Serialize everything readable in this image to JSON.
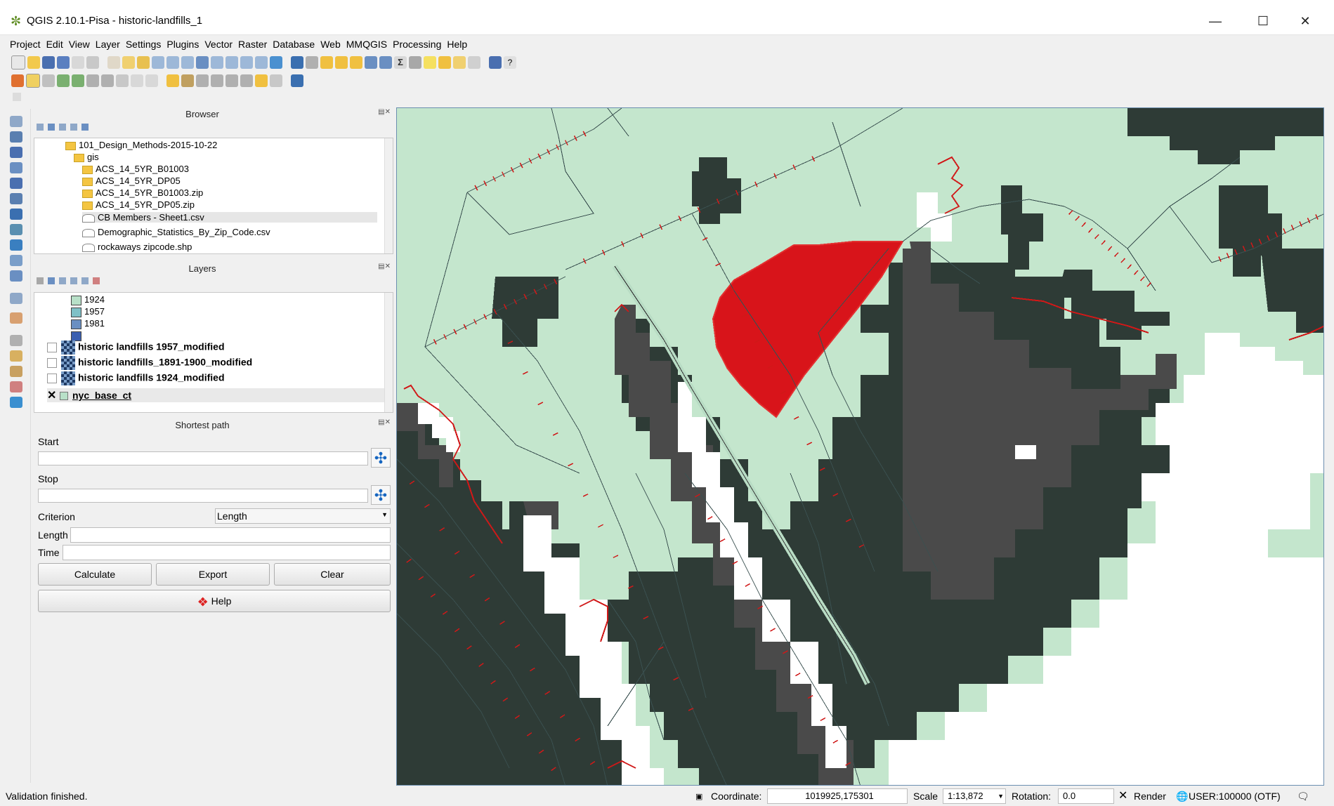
{
  "window": {
    "title": "QGIS 2.10.1-Pisa - historic-landfills_1",
    "minimize": "—",
    "maximize": "☐",
    "close": "✕"
  },
  "menu": [
    "Project",
    "Edit",
    "View",
    "Layer",
    "Settings",
    "Plugins",
    "Vector",
    "Raster",
    "Database",
    "Web",
    "MMQGIS",
    "Processing",
    "Help"
  ],
  "browser": {
    "title": "Browser",
    "items": [
      {
        "label": "101_Design_Methods-2015-10-22",
        "type": "folder"
      },
      {
        "label": "gis",
        "type": "folder"
      },
      {
        "label": "ACS_14_5YR_B01003",
        "type": "folder"
      },
      {
        "label": "ACS_14_5YR_DP05",
        "type": "folder"
      },
      {
        "label": "ACS_14_5YR_B01003.zip",
        "type": "folder"
      },
      {
        "label": "ACS_14_5YR_DP05.zip",
        "type": "folder"
      },
      {
        "label": "CB Members - Sheet1.csv",
        "type": "file"
      },
      {
        "label": "Demographic_Statistics_By_Zip_Code.csv",
        "type": "file"
      },
      {
        "label": "rockaways zipcode.shp",
        "type": "file"
      }
    ]
  },
  "layers": {
    "title": "Layers",
    "legend": [
      {
        "label": "1924",
        "color": "#b8e0c8"
      },
      {
        "label": "1957",
        "color": "#7fc0c6"
      },
      {
        "label": "1981",
        "color": "#6a8fc2"
      },
      {
        "label": "",
        "color": "#3b5fb0"
      }
    ],
    "items": [
      {
        "label": "historic landfills 1957_modified"
      },
      {
        "label": "historic landfills_1891-1900_modified"
      },
      {
        "label": "historic landfills 1924_modified"
      },
      {
        "label": "nyc_base_ct"
      }
    ]
  },
  "shortest_path": {
    "title": "Shortest path",
    "start_label": "Start",
    "stop_label": "Stop",
    "criterion_label": "Criterion",
    "criterion_value": "Length",
    "length_label": "Length",
    "time_label": "Time",
    "calculate": "Calculate",
    "export": "Export",
    "clear": "Clear",
    "help": "Help"
  },
  "status": {
    "message": "Validation finished.",
    "coordinate_label": "Coordinate:",
    "coordinate_value": "1019925,175301",
    "scale_label": "Scale",
    "scale_value": "1:13,872",
    "rotation_label": "Rotation:",
    "rotation_value": "0.0",
    "render_label": "Render",
    "crs": "USER:100000 (OTF)"
  },
  "colors": {
    "map_background": "#c4e6cd",
    "landfill_dark": "#2e3b36",
    "landfill_mid": "#4a4a4a",
    "selection_red": "#d8141a",
    "road_lines": "#3a5050",
    "tick_red": "#d01818"
  },
  "icons": {
    "app": "qgis-logo-icon",
    "pick_point": "crosshair-icon",
    "help": "help-lifebuoy-icon"
  }
}
